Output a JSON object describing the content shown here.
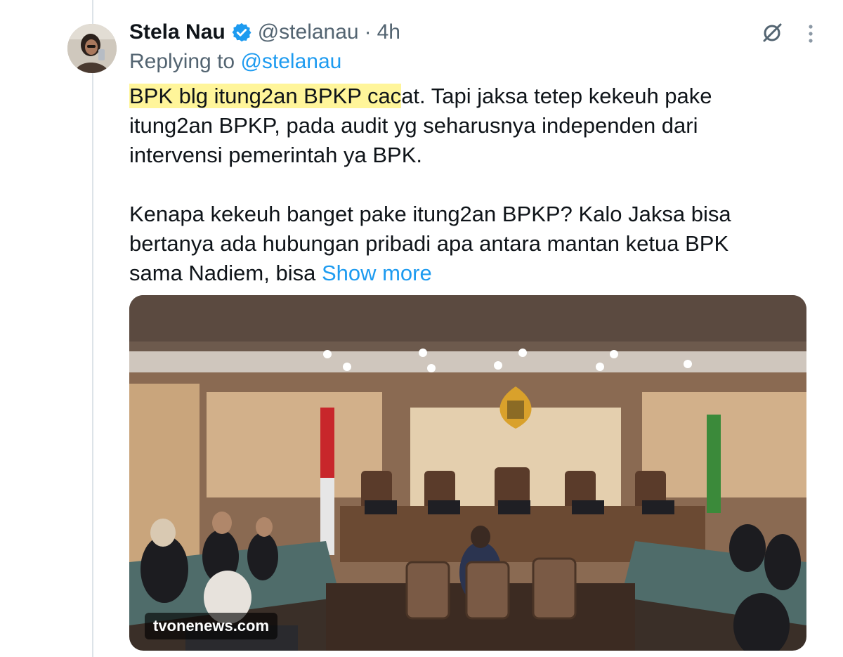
{
  "tweet": {
    "display_name": "Stela Nau",
    "handle": "@stelanau",
    "separator": "·",
    "time": "4h",
    "reply_prefix": "Replying to",
    "reply_handle": "@stelanau",
    "line1_highlight": "BPK blg itung2an BPKP cac",
    "line1_rest": "at. Tapi jaksa tetep kekeuh pake",
    "line2": "itung2an BPKP, pada audit yg seharusnya independen dari",
    "line3": "intervensi pemerintah ya BPK.",
    "line4": "Kenapa kekeuh banget pake itung2an BPKP? Kalo Jaksa bisa",
    "line5": "bertanya ada hubungan pribadi apa antara mantan ketua BPK",
    "line6_text": "sama Nadiem, bisa ",
    "show_more": "Show more"
  },
  "media": {
    "watermark": "tvonenews.com"
  },
  "icons": {
    "verified": "verified-badge-icon",
    "grok": "grok-icon",
    "more": "more-vertical-icon"
  },
  "colors": {
    "accent": "#1d9bf0",
    "secondary_text": "#536471",
    "highlight": "#fff59a"
  }
}
